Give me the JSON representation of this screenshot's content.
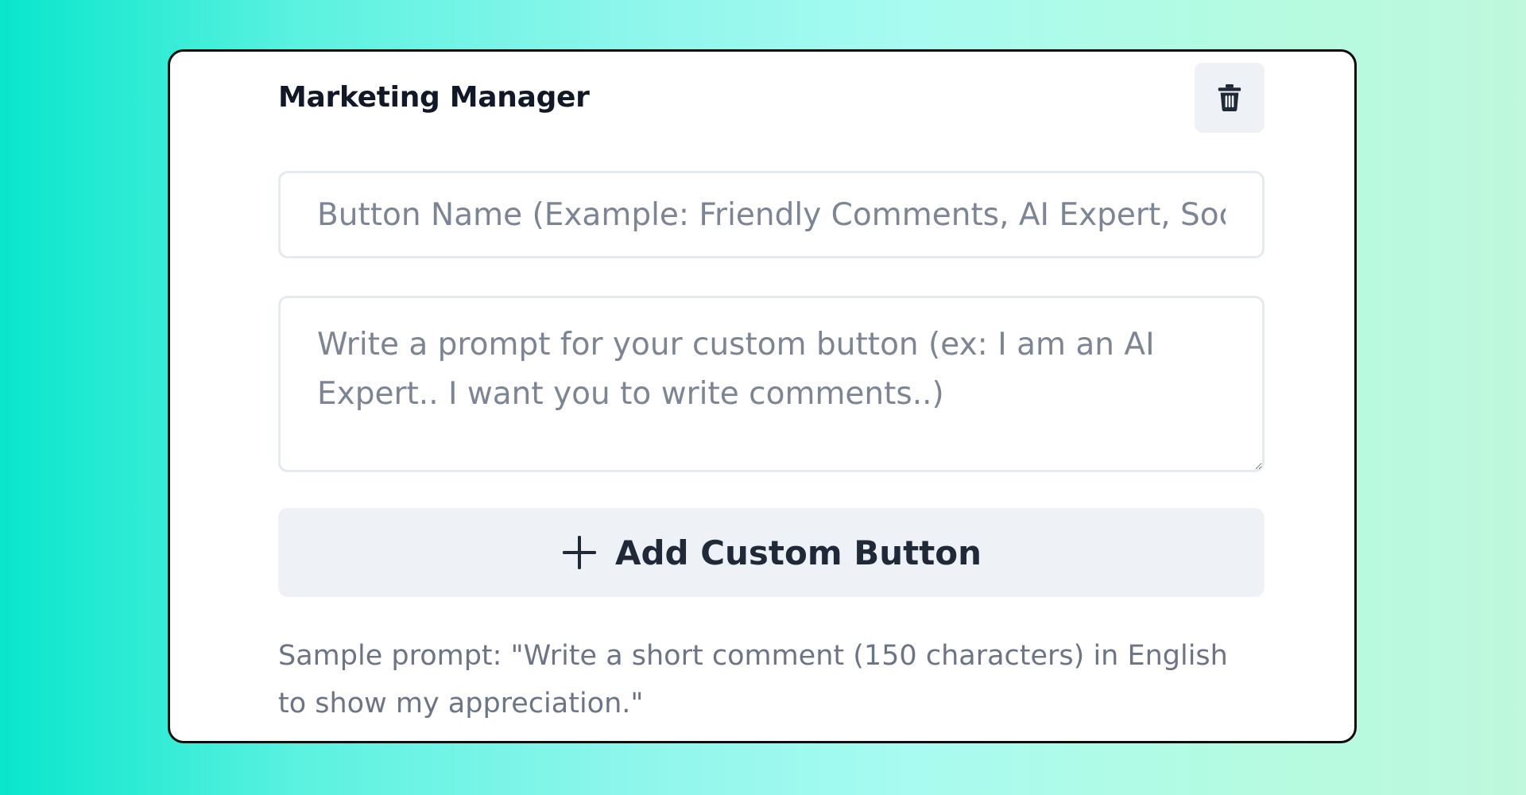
{
  "card": {
    "title": "Marketing Manager",
    "delete_icon": "trash-icon"
  },
  "name_input": {
    "value": "",
    "placeholder": "Button Name (Example: Friendly Comments, AI Expert, Social Media Manager)"
  },
  "prompt_input": {
    "value": "",
    "placeholder": "Write a prompt for your custom button (ex: I am an AI Expert.. I want you to write comments..)"
  },
  "add_button": {
    "icon": "plus-icon",
    "label": "Add Custom Button"
  },
  "sample_prompt": "Sample prompt: \"Write a short comment (150 characters) in English to show my appreciation.\"",
  "colors": {
    "background_start": "#08e6cc",
    "background_end": "#bff8dc",
    "card_border": "#0b0b0b",
    "button_bg": "#eef2f7",
    "placeholder_text": "#7b8594"
  }
}
